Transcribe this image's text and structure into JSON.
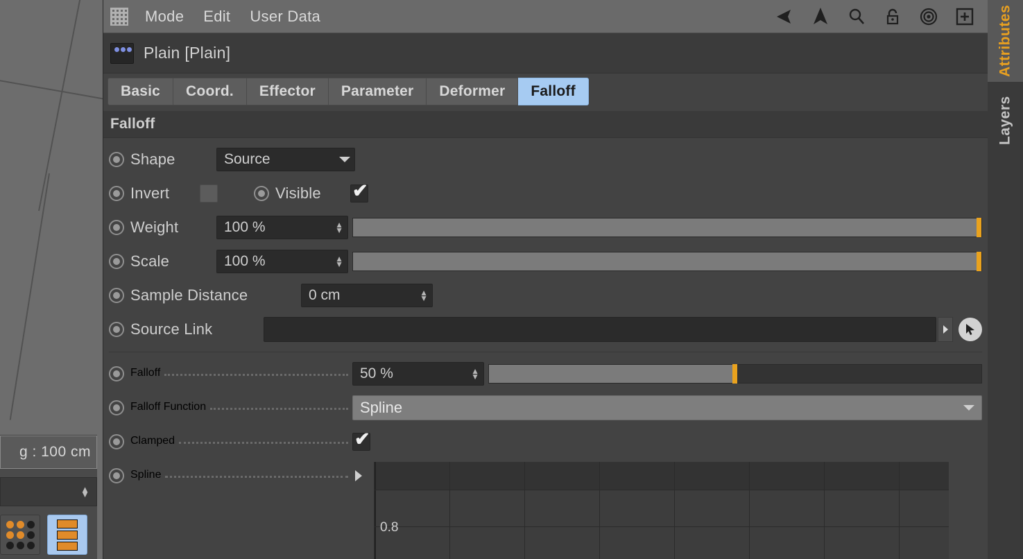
{
  "viewport": {
    "measure_text": "g : 100 cm",
    "spinner_value": "",
    "mode_buttons": [
      {
        "name": "dot-grid-button",
        "selected": false
      },
      {
        "name": "block-stack-button",
        "selected": true
      }
    ]
  },
  "menubar": {
    "grid_icon": "grid-icon",
    "items": [
      "Mode",
      "Edit",
      "User Data"
    ],
    "icons": [
      "back-arrow-icon",
      "up-arrow-icon",
      "search-icon",
      "lock-icon",
      "target-icon",
      "add-box-icon"
    ]
  },
  "object": {
    "icon": "plain-effector-icon",
    "name": "Plain [Plain]"
  },
  "tabs": [
    {
      "label": "Basic",
      "active": false
    },
    {
      "label": "Coord.",
      "active": false
    },
    {
      "label": "Effector",
      "active": false
    },
    {
      "label": "Parameter",
      "active": false
    },
    {
      "label": "Deformer",
      "active": false
    },
    {
      "label": "Falloff",
      "active": true
    }
  ],
  "section": {
    "title": "Falloff"
  },
  "fields": {
    "shape": {
      "label": "Shape",
      "value": "Source"
    },
    "invert": {
      "label": "Invert",
      "checked": false
    },
    "visible": {
      "label": "Visible",
      "checked": true
    },
    "weight": {
      "label": "Weight",
      "value": "100 %",
      "percent": 100
    },
    "scale": {
      "label": "Scale",
      "value": "100 %",
      "percent": 100
    },
    "sample_distance": {
      "label": "Sample Distance",
      "value": "0 cm"
    },
    "source_link": {
      "label": "Source Link",
      "value": ""
    },
    "falloff": {
      "label": "Falloff",
      "value": "50 %",
      "percent": 50
    },
    "falloff_function": {
      "label": "Falloff Function",
      "value": "Spline"
    },
    "clamped": {
      "label": "Clamped",
      "checked": true
    },
    "spline": {
      "label": "Spline"
    }
  },
  "graph": {
    "ytick_label": "0.8"
  },
  "side_tabs": [
    {
      "label": "Attributes",
      "active": true
    },
    {
      "label": "Layers",
      "active": false
    }
  ],
  "colors": {
    "accent_orange": "#e9a21e",
    "tab_active_blue": "#a6cbf2",
    "panel_bg": "#434343",
    "field_bg": "#2b2b2b"
  }
}
